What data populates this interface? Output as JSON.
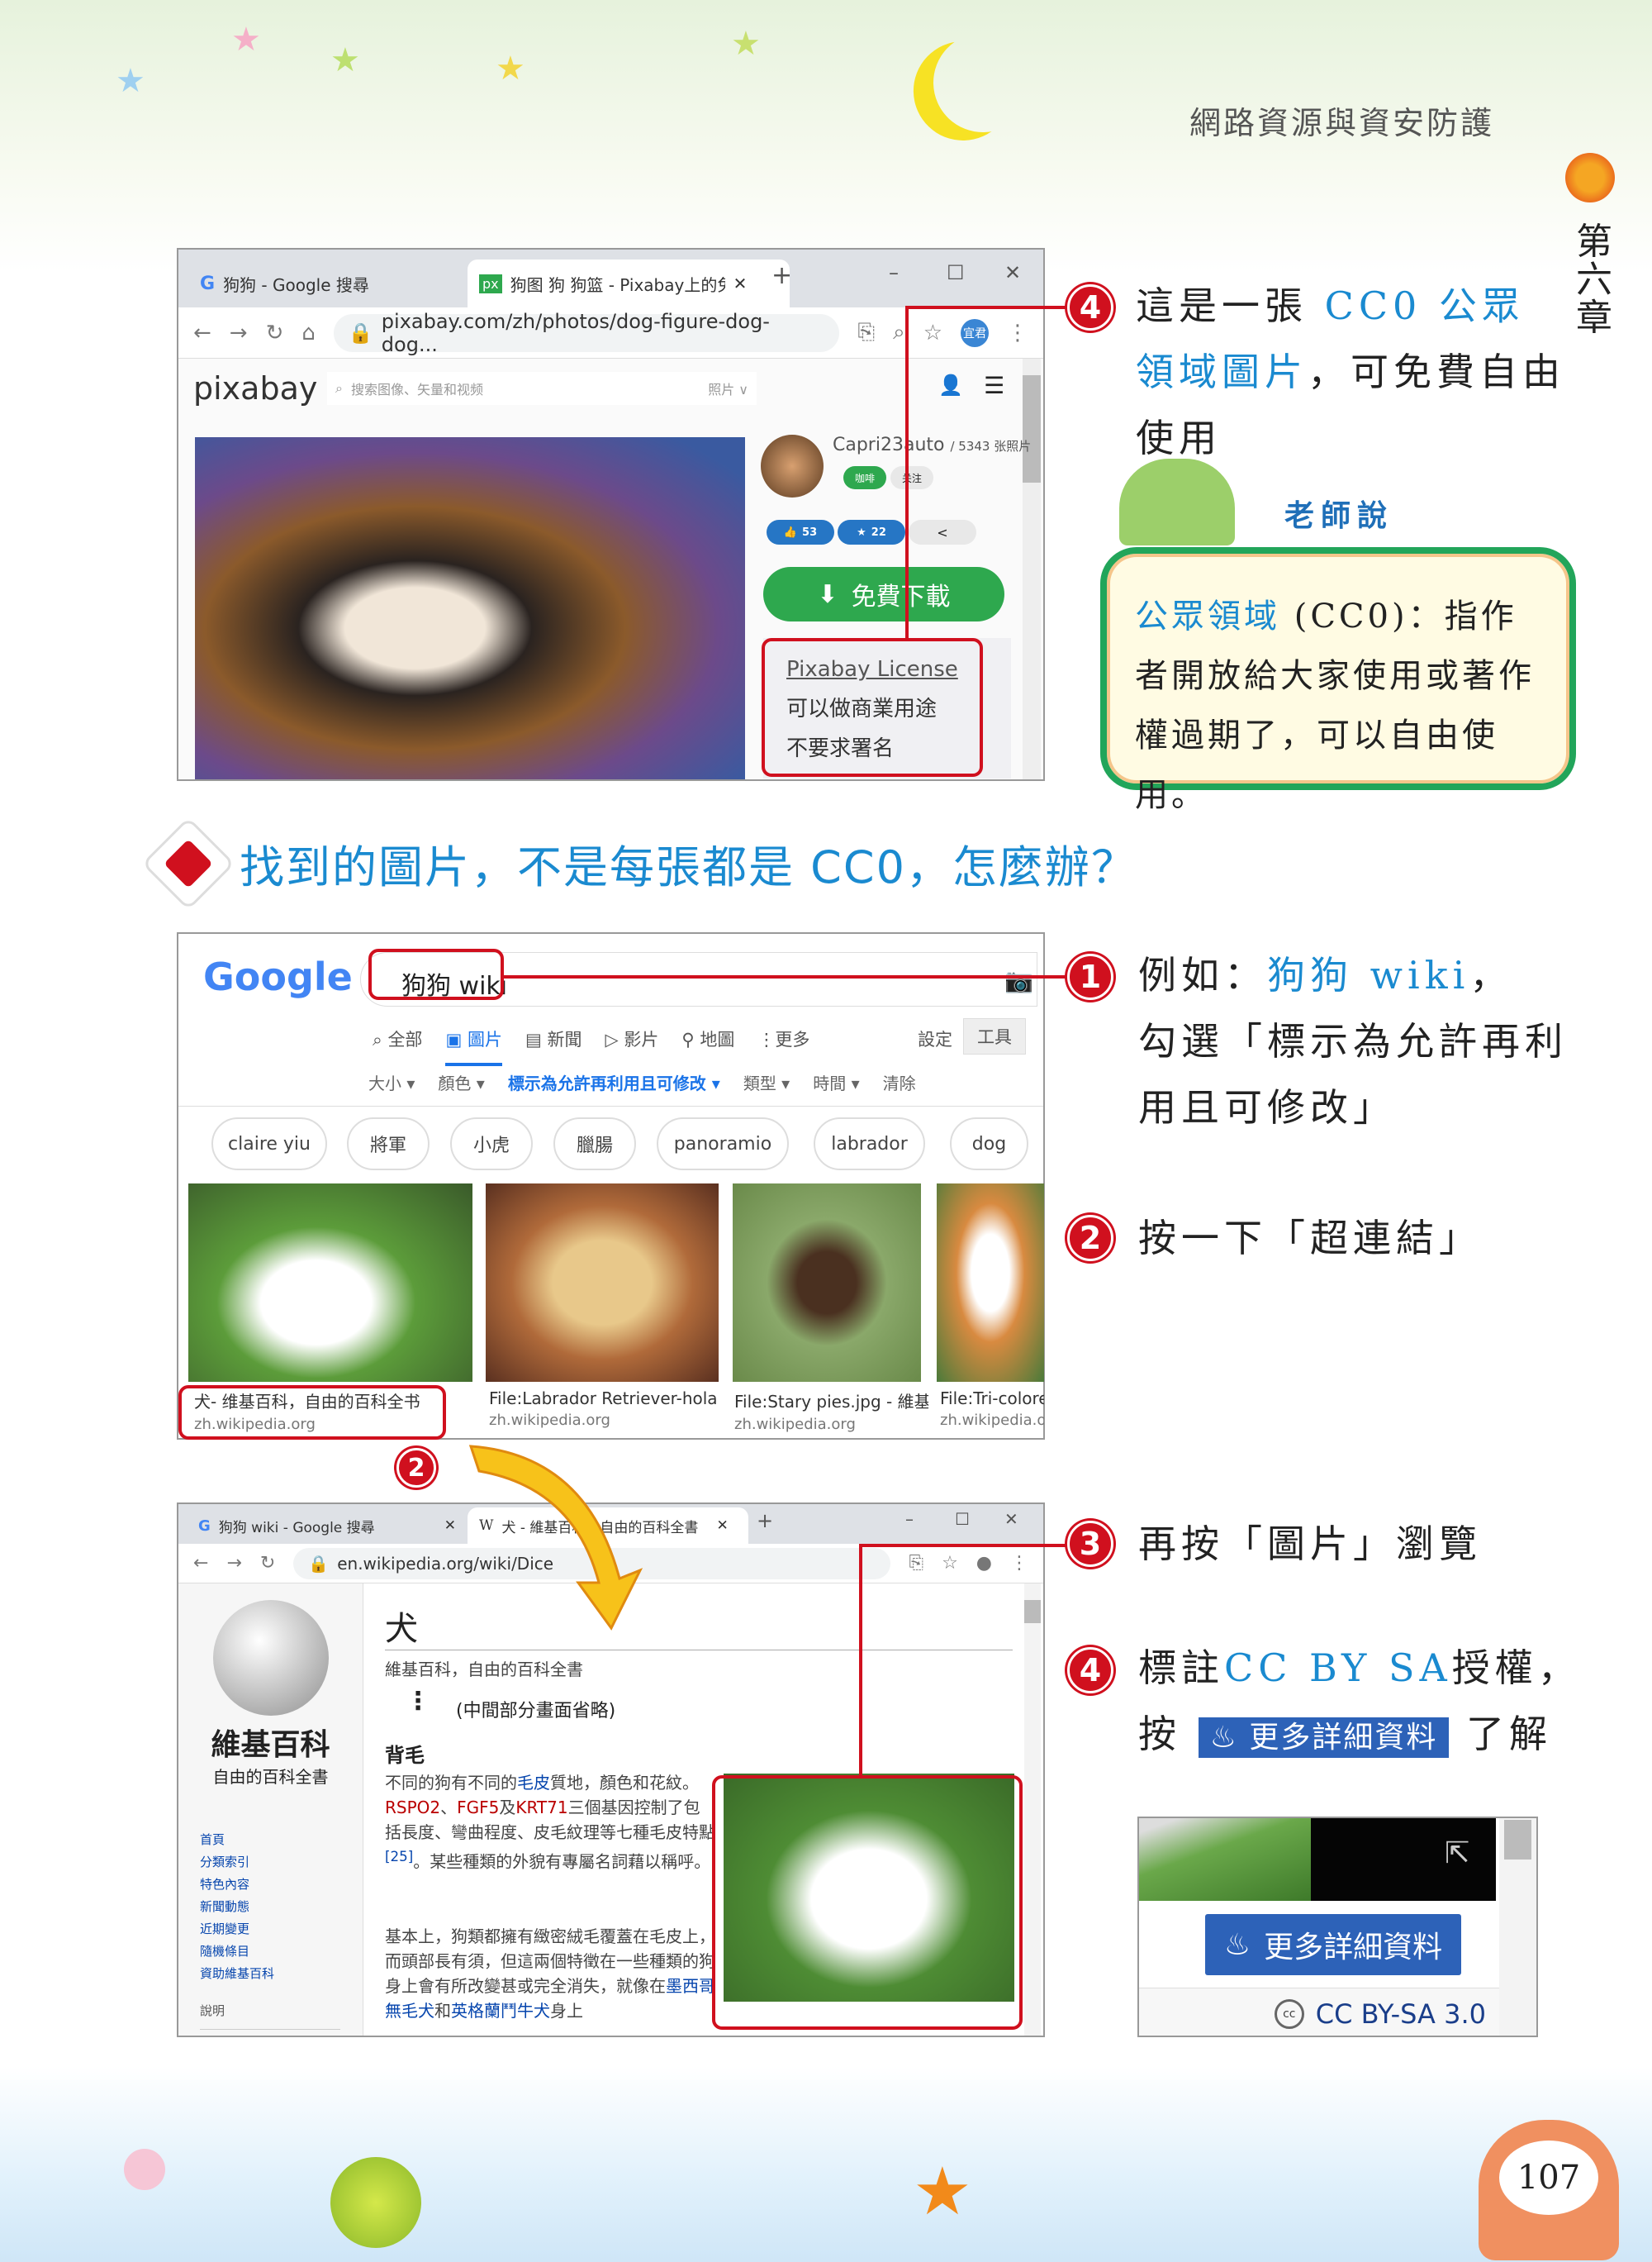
{
  "header": {
    "book_section": "網路資源與資安防護",
    "chapter": "第六章",
    "page_number": "107"
  },
  "browser1": {
    "tabs": [
      {
        "icon": "google-icon",
        "label": "狗狗 - Google 搜尋"
      },
      {
        "icon": "pixabay-icon",
        "icon_text": "px",
        "label": "狗图 狗 狗篮 - Pixabay上的免"
      }
    ],
    "url": "pixabay.com/zh/photos/dog-figure-dog-dog...",
    "avatar_text": "宜君",
    "site_logo": "pixabay",
    "search_placeholder": "搜索图像、矢量和视频",
    "search_type": "照片 ∨",
    "author": "Capri23auto",
    "author_count": "/ 5343 张照片",
    "coffee_btn": "咖啡",
    "follow_btn": "关注",
    "likes": "53",
    "favorites": "22",
    "download_btn": "免費下載",
    "license_link": "Pixabay License",
    "license_lines": [
      "可以做商業用途",
      "不要求署名"
    ]
  },
  "annotation_top": {
    "number": "4",
    "text_pre": "這是一張 ",
    "text_blue": "CC0 公眾領域圖片",
    "text_post": "，可免費自由使用"
  },
  "teacher_says": {
    "label": "老師說",
    "term": "公眾領域",
    "body": " (CC0)：指作者開放給大家使用或著作權過期了，可以自由使用。"
  },
  "section_heading": "找到的圖片，不是每張都是 CC0，怎麼辦？",
  "browser2": {
    "logo": "Google",
    "query": "狗狗 wiki",
    "nav": [
      "全部",
      "圖片",
      "新聞",
      "影片",
      "地圖",
      "更多"
    ],
    "nav_icons": [
      "search-icon",
      "image-icon",
      "news-icon",
      "video-icon",
      "map-pin-icon",
      "more-icon"
    ],
    "settings": "設定",
    "tools": "工具",
    "filters": [
      "大小 ▾",
      "顏色 ▾",
      "標示為允許再利用且可修改 ▾",
      "類型 ▾",
      "時間 ▾",
      "清除"
    ],
    "chips": [
      "claire yiu",
      "將軍",
      "小虎",
      "臘腸",
      "panoramio",
      "labrador",
      "dog"
    ],
    "results": [
      {
        "title": "犬- 维基百科，自由的百科全书",
        "source": "zh.wikipedia.org"
      },
      {
        "title": "File:Labrador Retriever-hola ...",
        "source": "zh.wikipedia.org"
      },
      {
        "title": "File:Stary pies.jpg - 維基...",
        "source": "zh.wikipedia.org"
      },
      {
        "title": "File:Tri-colore",
        "source": "zh.wikipedia.or"
      }
    ]
  },
  "annotation_1": {
    "number": "1",
    "pre": "例如：",
    "blue": "狗狗 wiki",
    "post": "，",
    "line2": "勾選「標示為允許再利用且可修改」"
  },
  "annotation_2": {
    "number": "2",
    "text": "按一下「超連結」"
  },
  "annotation_3": {
    "number": "3",
    "text": "再按「圖片」瀏覽"
  },
  "annotation_4": {
    "number": "4",
    "pre": "標註",
    "blue": "CC BY SA",
    "post": "授權，",
    "line2_pre": "按",
    "button": "更多詳細資料",
    "line2_post": "了解"
  },
  "browser3": {
    "tabs": [
      {
        "label": "狗狗 wiki - Google 搜尋"
      },
      {
        "icon_text": "W",
        "label": "犬 - 維基百科，自由的百科全書"
      }
    ],
    "url": "en.wikipedia.org/wiki/Dice",
    "wiki_name": "維基百科",
    "wiki_tagline": "自由的百科全書",
    "sidebar": [
      "首頁",
      "分類索引",
      "特色內容",
      "新聞動態",
      "近期變更",
      "隨機條目",
      "資助維基百科"
    ],
    "sidebar_help": [
      "說明",
      "說明"
    ],
    "title": "犬",
    "subtitle": "維基百科，自由的百科全書",
    "omitted": "(中間部分畫面省略)",
    "section": "背毛",
    "p1_a": "不同的狗有不同的",
    "p1_link": "毛皮",
    "p1_b": "質地，顏色和花紋。",
    "p1_red1": "RSPO2",
    "p1_c": "、",
    "p1_red2": "FGF5",
    "p1_d": "及",
    "p1_red3": "KRT71",
    "p1_e": "三個基因控制了包括長度、彎曲程度、皮毛紋理等七種毛皮特點",
    "p1_ref": "[25]",
    "p1_f": "。某些種類的外貌有專屬名詞藉以稱呼。",
    "p2_a": "基本上，狗類都擁有緻密絨毛覆蓋在毛皮上，而頭部長有須，但這兩個特徵在一些種類的狗身上會有所改變甚或完全消失，就像在",
    "p2_link1": "墨西哥無毛犬",
    "p2_b": "和",
    "p2_link2": "英格蘭鬥牛犬",
    "p2_c": "身上"
  },
  "detail_panel": {
    "button": "更多詳細資料",
    "license": "CC BY-SA 3.0",
    "cc_icon": "cc"
  },
  "colors": {
    "accent_blue": "#1a8ad0",
    "annotation_red": "#d0101e",
    "pixabay_green": "#2ea84e",
    "wiki_blue": "#3366cc",
    "teacher_border": "#22a55a"
  }
}
